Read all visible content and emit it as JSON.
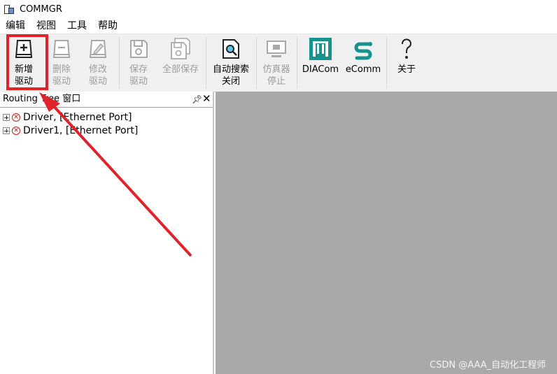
{
  "window": {
    "title": "COMMGR"
  },
  "menu": [
    "编辑",
    "视图",
    "工具",
    "帮助"
  ],
  "toolbar": {
    "new_driver": [
      "新增",
      "驱动"
    ],
    "delete_driver": [
      "删除",
      "驱动"
    ],
    "modify_driver": [
      "修改",
      "驱动"
    ],
    "save_driver": [
      "保存",
      "驱动"
    ],
    "save_all": "全部保存",
    "auto_search": [
      "自动搜索",
      "关闭"
    ],
    "stop_sim": [
      "仿真器",
      "停止"
    ],
    "diacom": "DIACom",
    "ecomm": "eComm",
    "about": "关于"
  },
  "routing_panel": {
    "title": "Routing Tree 窗口",
    "items": [
      {
        "name": "Driver,",
        "port": "[Ethernet Port]",
        "status": "error"
      },
      {
        "name": "Driver1,",
        "port": "[Ethernet Port]",
        "status": "error"
      }
    ]
  },
  "annotation": {
    "color": "#e0232b"
  },
  "watermark": "CSDN @AAA_自动化工程师",
  "colors": {
    "workspace": "#a9a9a9",
    "toolbar": "#f0f0f0",
    "teal_icon": "#16938d"
  }
}
